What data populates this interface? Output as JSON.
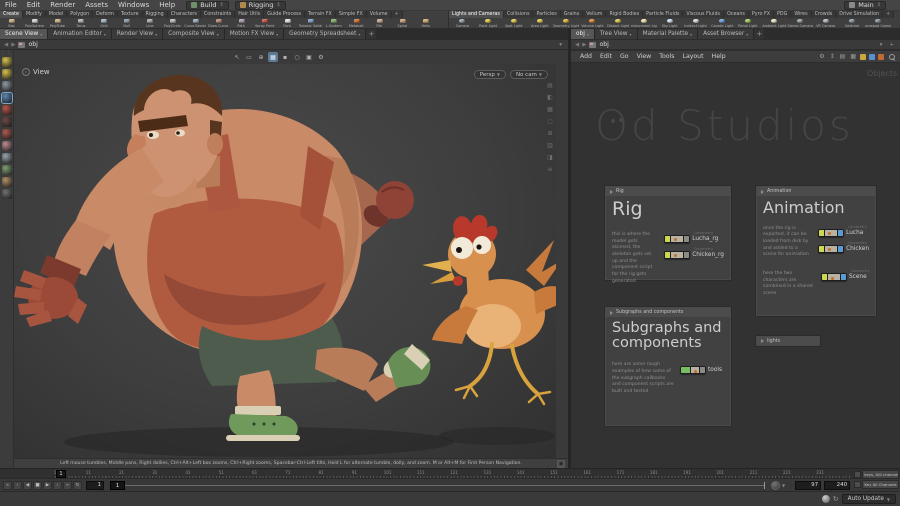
{
  "icons": {
    "gear": "⚙",
    "updown": "↕",
    "list": "▤",
    "grid": "▦",
    "refresh": "↻",
    "caret": "▼",
    "plus": "+",
    "back": "◀",
    "fwd": "▶",
    "pin": "▾",
    "dots": "⋮⋮",
    "help_btn": "▣"
  },
  "menubar": {
    "items": [
      {
        "label": "File"
      },
      {
        "label": "Edit"
      },
      {
        "label": "Render"
      },
      {
        "label": "Assets"
      },
      {
        "label": "Windows"
      },
      {
        "label": "Help"
      }
    ],
    "desktop_label": "Build",
    "toolset_label": "Rigging",
    "main_label": "Main"
  },
  "shelf_left": {
    "tabs": [
      {
        "label": "Create",
        "active": true
      },
      {
        "label": "Modify"
      },
      {
        "label": "Model"
      },
      {
        "label": "Polygon"
      },
      {
        "label": "Deform"
      },
      {
        "label": "Texture"
      },
      {
        "label": "Rigging"
      },
      {
        "label": "Characters"
      },
      {
        "label": "Constraints"
      },
      {
        "label": "Hair Utils"
      },
      {
        "label": "Guide Process"
      },
      {
        "label": "Terrain FX"
      },
      {
        "label": "Simple FX"
      },
      {
        "label": "Volume"
      },
      {
        "label": "+",
        "add": true
      }
    ],
    "tools": [
      {
        "label": "Box",
        "color": "#c9b08a"
      },
      {
        "label": "PolySphere",
        "color": "#d2d2d2"
      },
      {
        "label": "PolyTube",
        "color": "#c9b08a"
      },
      {
        "label": "Torus",
        "color": "#b0b0b0"
      },
      {
        "label": "Grid",
        "color": "#9fb4c4"
      },
      {
        "label": "Null",
        "color": "#8a9aa8"
      },
      {
        "label": "Line",
        "color": "#a8a8a8"
      },
      {
        "label": "PolyCircle",
        "color": "#b8b8b8"
      },
      {
        "label": "Curve Bezier",
        "color": "#96aabb"
      },
      {
        "label": "Draw Curve",
        "color": "#b8877a"
      },
      {
        "label": "Path",
        "color": "#a89ab0"
      },
      {
        "label": "Spray Paint",
        "color": "#c2574a"
      },
      {
        "label": "Font",
        "color": "#dedede"
      },
      {
        "label": "Platonic Solids",
        "color": "#7a9cc4"
      },
      {
        "label": "L-System",
        "color": "#7fb069"
      },
      {
        "label": "Metaball",
        "color": "#c87137"
      },
      {
        "label": "File",
        "color": "#c0a890"
      },
      {
        "label": "Spiral",
        "color": "#c8a07a"
      },
      {
        "label": "Helix",
        "color": "#caa96a"
      }
    ]
  },
  "shelf_right": {
    "tabs": [
      {
        "label": "Lights and Cameras",
        "active": true
      },
      {
        "label": "Collisions"
      },
      {
        "label": "Particles"
      },
      {
        "label": "Grains"
      },
      {
        "label": "Vellum"
      },
      {
        "label": "Rigid Bodies"
      },
      {
        "label": "Particle Fluids"
      },
      {
        "label": "Viscous Fluids"
      },
      {
        "label": "Oceans"
      },
      {
        "label": "Pyro FX"
      },
      {
        "label": "PDG"
      },
      {
        "label": "Wires"
      },
      {
        "label": "Crowds"
      },
      {
        "label": "Drive Simulation"
      },
      {
        "label": "+",
        "add": true
      }
    ],
    "tools": [
      {
        "label": "Camera",
        "color": "#9aa7b0"
      },
      {
        "label": "Point Light",
        "color": "#e3c94e"
      },
      {
        "label": "Spot Light",
        "color": "#e3c94e"
      },
      {
        "label": "Area Light",
        "color": "#e3c94e"
      },
      {
        "label": "Geometry Light",
        "color": "#d9b83e"
      },
      {
        "label": "Volume Light",
        "color": "#e0893e"
      },
      {
        "label": "Distant Light",
        "color": "#e3c94e"
      },
      {
        "label": "Environment Light",
        "color": "#f0e6b0"
      },
      {
        "label": "Sky Light",
        "color": "#cfe0ee"
      },
      {
        "label": "Indirect Light",
        "color": "#d8d8d8"
      },
      {
        "label": "Caustic Light",
        "color": "#6fa3d8"
      },
      {
        "label": "Portal Light",
        "color": "#a3cf62"
      },
      {
        "label": "Ambient Light",
        "color": "#efe6c8"
      },
      {
        "label": "Stereo Camera",
        "color": "#9aa7b0"
      },
      {
        "label": "VR Camera",
        "color": "#b0b8c0"
      },
      {
        "label": "Switcher",
        "color": "#8f9aa2"
      },
      {
        "label": "Gamepad Camera",
        "color": "#8f9aa2"
      }
    ]
  },
  "left_pane": {
    "tabs": [
      {
        "label": "Scene View",
        "active": true
      },
      {
        "label": "Animation Editor"
      },
      {
        "label": "Render View"
      },
      {
        "label": "Composite View"
      },
      {
        "label": "Motion FX View"
      },
      {
        "label": "Geometry Spreadsheet"
      }
    ],
    "path": "obj",
    "view_label": "View",
    "cam_pills": [
      {
        "label": "Persp"
      },
      {
        "label": "No cam"
      }
    ],
    "toolbar_icons": [
      {
        "g": "↖"
      },
      {
        "g": "▭"
      },
      {
        "g": "⊕"
      },
      {
        "g": "▦",
        "active": true
      },
      {
        "g": "▪"
      },
      {
        "g": "○"
      },
      {
        "g": "▣"
      },
      {
        "g": "⚙"
      }
    ],
    "left_strip_icons": [
      {
        "name": "point-light-icon",
        "color": "#d9c24a"
      },
      {
        "name": "spot-light-icon",
        "color": "#d9c24a"
      },
      {
        "name": "camera-icon",
        "color": "#909aa2"
      },
      {
        "name": "select-tool-icon",
        "color": "#5b87b0",
        "active": true
      },
      {
        "name": "sphere-red-icon",
        "color": "#b5574a"
      },
      {
        "name": "sphere-dark-icon",
        "color": "#6b4a44"
      },
      {
        "name": "material-icon",
        "color": "#b05a50"
      },
      {
        "name": "paint-icon",
        "color": "#c08a90"
      },
      {
        "name": "grid-icon",
        "color": "#9aa5ad"
      },
      {
        "name": "tree-icon",
        "color": "#7fa070"
      },
      {
        "name": "terrain-icon",
        "color": "#b09068"
      },
      {
        "name": "misc-icon",
        "color": "#707070"
      }
    ],
    "right_strip_icons": [
      {
        "g": "▤"
      },
      {
        "g": "◧"
      },
      {
        "g": "▦"
      },
      {
        "g": "○"
      },
      {
        "g": "⊞"
      },
      {
        "g": "▥"
      },
      {
        "g": "◨"
      },
      {
        "g": "≡"
      }
    ],
    "help_text": "Left mouse tumbles, Middle pans, Right dollies, Ctrl+Alt+Left box zooms, Ctrl+Right zooms, Spacebar-Ctrl-Left tilts, Hold L for alternate tumble, dolly, and zoom. M or Alt+M for First Person Navigation."
  },
  "right_pane": {
    "tabs": [
      {
        "label": "obj",
        "active": true
      },
      {
        "label": "Tree View"
      },
      {
        "label": "Material Palette"
      },
      {
        "label": "Asset Browser"
      }
    ],
    "path": "obj",
    "menu": [
      {
        "label": "Add"
      },
      {
        "label": "Edit"
      },
      {
        "label": "Go"
      },
      {
        "label": "View"
      },
      {
        "label": "Tools"
      },
      {
        "label": "Layout"
      },
      {
        "label": "Help"
      }
    ],
    "corner_label": "Objects",
    "watermark": "Od Studios",
    "boxes": {
      "rig": {
        "title": "Rig",
        "heading": "Rig",
        "desc": "this is where the model gets skinned, the skeleton gets set up and the component script for the rig gets generated",
        "nodes": [
          {
            "caption": "Geometry",
            "name": "Lucha_rg",
            "kind": "geo"
          },
          {
            "caption": "Geometry",
            "name": "Chicken_rg",
            "kind": "geo"
          }
        ]
      },
      "animation": {
        "title": "Animation",
        "heading": "Animation",
        "rows": [
          {
            "desc": "once the rig is exported, it can be loaded from disk by and added to a scene for animation",
            "nodes": [
              {
                "caption": "Geometry",
                "name": "Lucha",
                "kind": "anim"
              },
              {
                "caption": "Geometry",
                "name": "Chicken",
                "kind": "anim"
              }
            ]
          },
          {
            "desc": "here the two characters are combined in a shared scene",
            "nodes": [
              {
                "caption": "Geometry",
                "name": "Scene",
                "kind": "anim"
              }
            ]
          }
        ]
      },
      "subgraphs": {
        "title": "Subgraphs and components",
        "heading_line1": "Subgraphs and",
        "heading_line2": "components",
        "desc": "here are some rough examples of how some of the subgraph callbacks and component scripts are built and tested",
        "nodes": [
          {
            "caption": "",
            "name": "tools",
            "kind": "tool"
          }
        ]
      },
      "lights": {
        "title": "lights"
      }
    }
  },
  "playbar": {
    "transport": [
      {
        "g": "«"
      },
      {
        "g": "‹"
      },
      {
        "g": "◀"
      },
      {
        "g": "■"
      },
      {
        "g": "▶"
      },
      {
        "g": "›"
      },
      {
        "g": "»"
      },
      {
        "g": "↻"
      }
    ],
    "current_frame": "1",
    "start_frame": "1",
    "end_frame": "97",
    "global_end": "240",
    "ruler": {
      "start": 1,
      "end": 240,
      "step": 10
    },
    "keys_label": "0 keys, 0/0 channels",
    "key_all_label": "Key All Channels",
    "auto_update_label": "Auto Update"
  }
}
